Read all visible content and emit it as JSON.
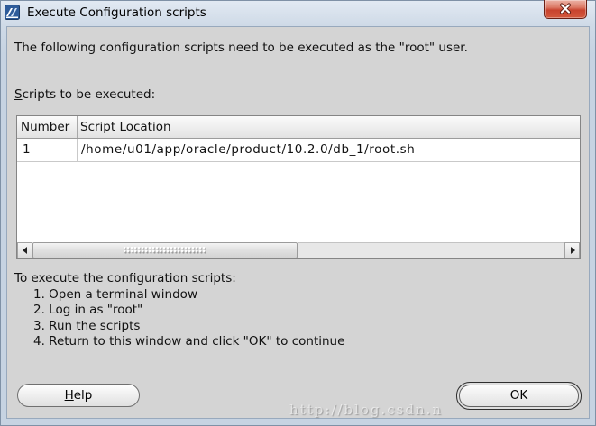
{
  "window": {
    "title": "Execute Configuration scripts",
    "icon": "oracle-installer-icon",
    "close_icon": "close-icon"
  },
  "dialog": {
    "intro": "The following configuration scripts need to be executed as the \"root\" user.",
    "scripts_label": "Scripts to be executed:",
    "table": {
      "columns": [
        "Number",
        "Script Location"
      ],
      "rows": [
        {
          "number": "1",
          "location": "/home/u01/app/oracle/product/10.2.0/db_1/root.sh"
        }
      ],
      "scrollbar": {
        "left_icon": "scroll-left-icon",
        "right_icon": "scroll-right-icon",
        "grip_icon": "grip-icon"
      }
    },
    "instructions": {
      "heading": "To execute the configuration scripts:",
      "steps": [
        "1. Open a terminal window",
        "2. Log in as \"root\"",
        "3. Run the scripts",
        "4. Return to this window and click \"OK\" to continue"
      ]
    }
  },
  "buttons": {
    "help": "Help",
    "ok": "OK"
  },
  "watermark": "http://blog.csdn.n",
  "colors": {
    "frame": "#c6d3e2",
    "body": "#d4d4d4",
    "close_button": "#c8432e"
  }
}
